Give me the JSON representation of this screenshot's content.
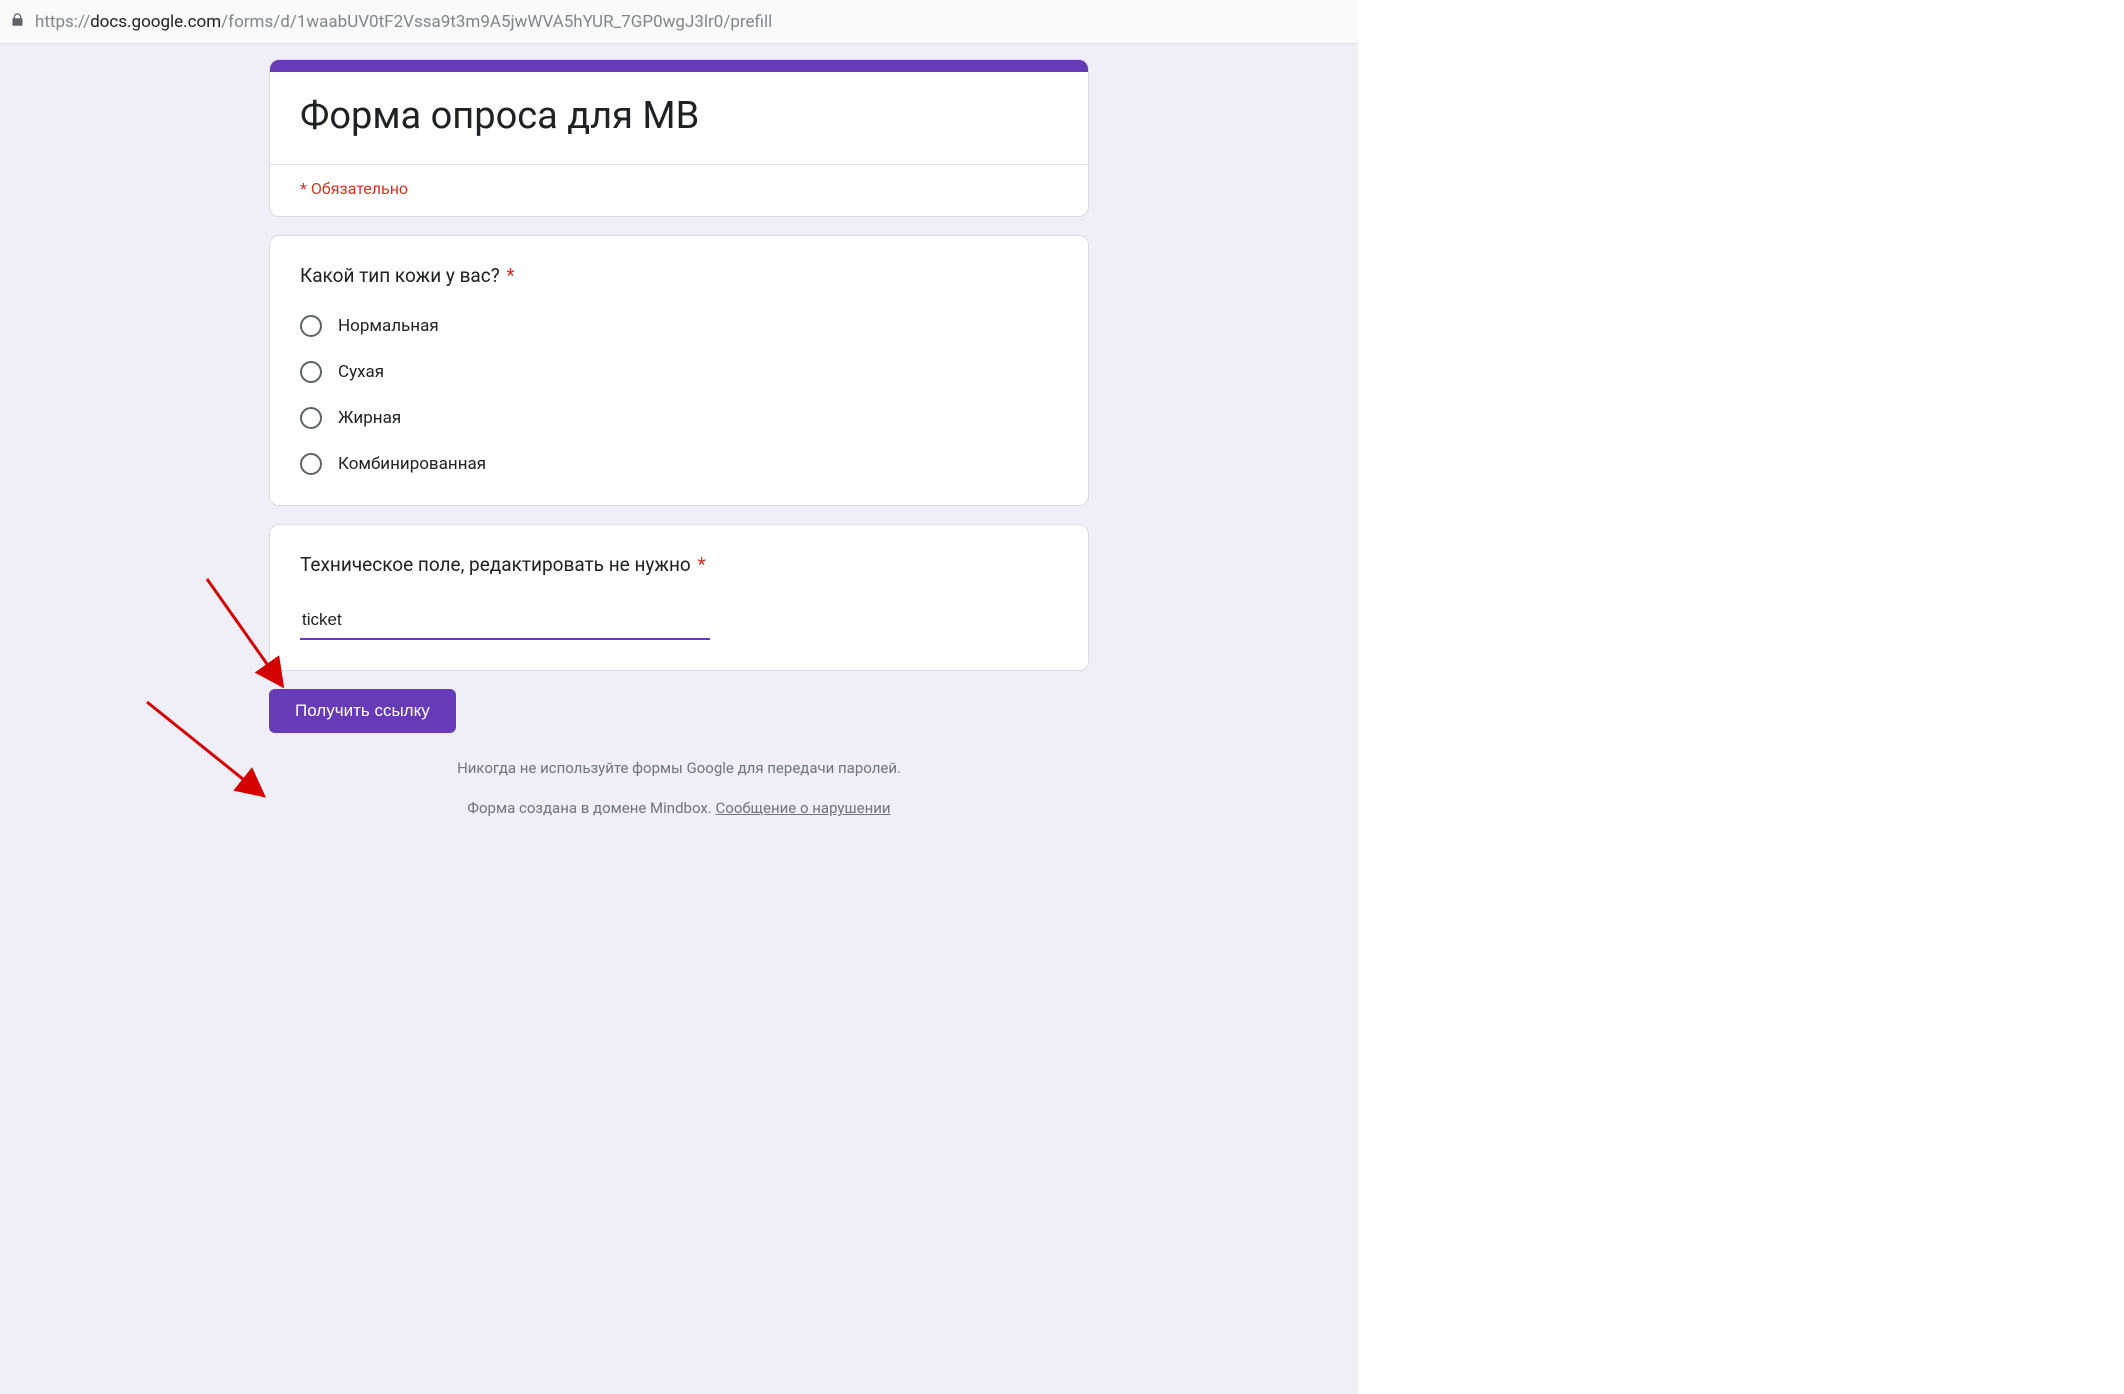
{
  "address_bar": {
    "url_scheme_hidden": "https://",
    "url_host": "docs.google.com",
    "url_path": "/forms/d/1waabUV0tF2Vssa9t3m9A5jwWVA5hYUR_7GP0wgJ3lr0/prefill",
    "lock_icon": "lock-icon"
  },
  "form": {
    "title": "Форма опроса для MB",
    "required_legend": "* Обязательно",
    "questions": [
      {
        "label": "Какой тип кожи у вас?",
        "required": true,
        "type": "radio",
        "options": [
          "Нормальная",
          "Сухая",
          "Жирная",
          "Комбинированная"
        ]
      },
      {
        "label": "Техническое поле, редактировать не нужно",
        "required": true,
        "type": "text",
        "value": "ticket"
      }
    ],
    "submit_label": "Получить ссылку"
  },
  "footer": {
    "warning": "Никогда не используйте формы Google для передачи паролей.",
    "created_prefix": "Форма создана в домене Mindbox. ",
    "report_link": "Сообщение о нарушении"
  },
  "colors": {
    "accent": "#673ab7",
    "required": "#d93025",
    "page_bg": "#f0eef7"
  }
}
